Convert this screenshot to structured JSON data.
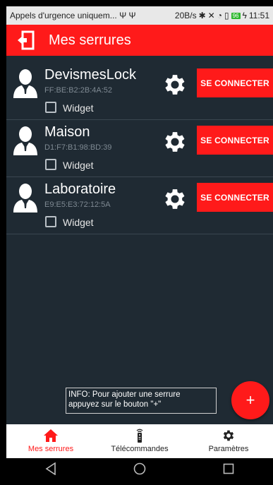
{
  "status_bar": {
    "left_text": "Appels d'urgence uniquem...",
    "usb_symbols": "Ψ Ψ",
    "network_speed": "20B/s",
    "battery_level": "96",
    "time": "11:51"
  },
  "app_bar": {
    "title": "Mes serrures"
  },
  "locks": [
    {
      "name": "DevismesLock",
      "mac": "FF:BE:B2:2B:4A:52",
      "widget_label": "Widget",
      "connect_label": "SE CONNECTER"
    },
    {
      "name": "Maison",
      "mac": "D1:F7:B1:98:BD:39",
      "widget_label": "Widget",
      "connect_label": "SE CONNECTER"
    },
    {
      "name": "Laboratoire",
      "mac": "E9:E5:E3:72:12:5A",
      "widget_label": "Widget",
      "connect_label": "SE CONNECTER"
    }
  ],
  "info": {
    "line1": "INFO: Pour ajouter une serrure",
    "line2": "appuyez sur le bouton \"+\""
  },
  "fab": {
    "label": "+"
  },
  "bottom_nav": {
    "items": [
      {
        "label": "Mes serrures",
        "icon": "home-icon"
      },
      {
        "label": "Télécommandes",
        "icon": "remote-icon"
      },
      {
        "label": "Paramètres",
        "icon": "gear-icon"
      }
    ]
  },
  "colors": {
    "accent": "#ff1a1a",
    "background": "#1f2a33",
    "divider": "#3a4650"
  }
}
